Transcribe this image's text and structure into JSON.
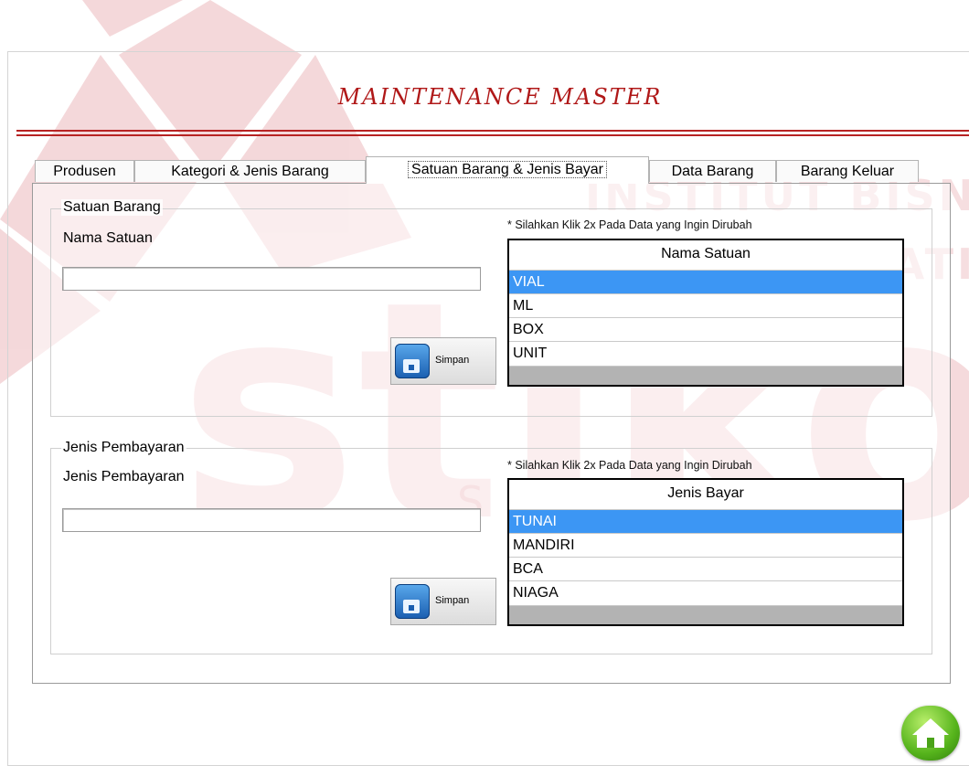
{
  "title": "MAINTENANCE MASTER",
  "tabs": [
    {
      "label": "Produsen"
    },
    {
      "label": "Kategori & Jenis Barang"
    },
    {
      "label": "Satuan Barang & Jenis Bayar"
    },
    {
      "label": "Data Barang"
    },
    {
      "label": "Barang Keluar"
    }
  ],
  "active_tab": "Satuan Barang & Jenis Bayar",
  "watermark": {
    "logo_text": "stikom",
    "line1": "INSTITUT BISNIS",
    "line2": "DAN INFORMATIKA",
    "line3": "SURABAYA"
  },
  "satuan": {
    "group_title": "Satuan Barang",
    "field_label": "Nama Satuan",
    "field_value": "",
    "hint": "* Silahkan Klik 2x Pada Data yang Ingin Dirubah",
    "button_label": "Simpan",
    "table_header": "Nama Satuan",
    "rows": [
      "VIAL",
      "ML",
      "BOX",
      "UNIT"
    ],
    "selected": "VIAL"
  },
  "bayar": {
    "group_title": "Jenis Pembayaran",
    "field_label": "Jenis Pembayaran",
    "field_value": "",
    "hint": "* Silahkan Klik 2x Pada Data yang Ingin Dirubah",
    "button_label": "Simpan",
    "table_header": "Jenis Bayar",
    "rows": [
      "TUNAI",
      "MANDIRI",
      "BCA",
      "NIAGA"
    ],
    "selected": "TUNAI"
  },
  "colors": {
    "title": "#b01818",
    "rule": "#b72323",
    "selected_row": "#3c96f4",
    "watermark": "#e8b8b8"
  },
  "icons": {
    "save": "floppy-disk-icon",
    "home": "home-icon"
  }
}
